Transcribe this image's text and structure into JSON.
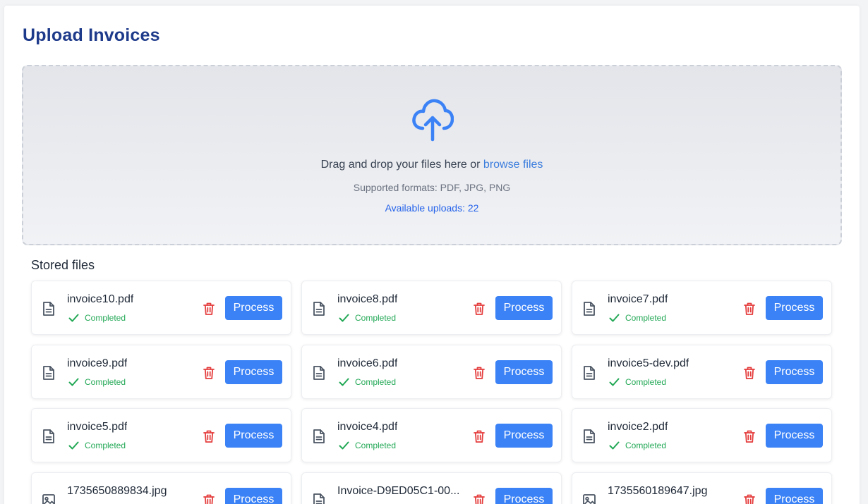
{
  "page_title": "Upload Invoices",
  "dropzone": {
    "icon": "cloud-upload-icon",
    "text": "Drag and drop your files here or ",
    "browse_link": "browse files",
    "formats": "Supported formats: PDF, JPG, PNG",
    "available": "Available uploads: 22"
  },
  "stored_files": {
    "title": "Stored files",
    "process_label": "Process",
    "items": [
      {
        "name": "invoice10.pdf",
        "status": "Completed",
        "type": "document-icon"
      },
      {
        "name": "invoice8.pdf",
        "status": "Completed",
        "type": "document-icon"
      },
      {
        "name": "invoice7.pdf",
        "status": "Completed",
        "type": "document-icon"
      },
      {
        "name": "invoice9.pdf",
        "status": "Completed",
        "type": "document-icon"
      },
      {
        "name": "invoice6.pdf",
        "status": "Completed",
        "type": "document-icon"
      },
      {
        "name": "invoice5-dev.pdf",
        "status": "Completed",
        "type": "document-icon"
      },
      {
        "name": "invoice5.pdf",
        "status": "Completed",
        "type": "document-icon"
      },
      {
        "name": "invoice4.pdf",
        "status": "Completed",
        "type": "document-icon"
      },
      {
        "name": "invoice2.pdf",
        "status": "Completed",
        "type": "document-icon"
      },
      {
        "name": "1735650889834.jpg",
        "status": "",
        "type": "image-icon"
      },
      {
        "name": "Invoice-D9ED05C1-00...",
        "status": "",
        "type": "document-icon"
      },
      {
        "name": "1735560189647.jpg",
        "status": "",
        "type": "image-icon"
      }
    ]
  },
  "colors": {
    "title": "#1e3a8a",
    "accent": "#3b82f6",
    "success": "#22a855",
    "danger": "#e53e3e"
  }
}
